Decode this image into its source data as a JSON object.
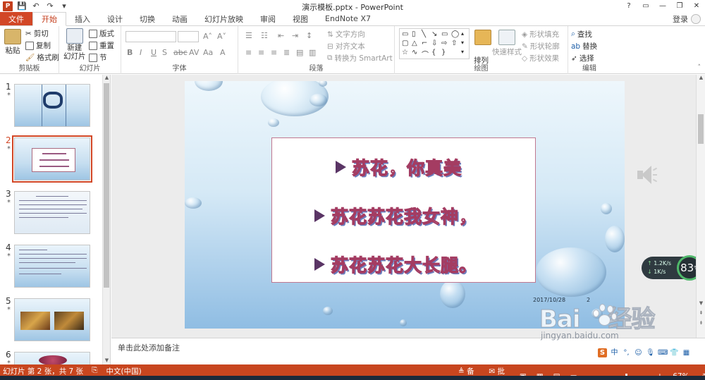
{
  "window": {
    "title": "演示模板.pptx - PowerPoint",
    "login": "登录",
    "help_glyph": "?",
    "minimize_glyph": "—",
    "restore_glyph": "❐",
    "close_glyph": "✕"
  },
  "quick_access": {
    "app_glyph": "P",
    "save_glyph": "💾",
    "undo_glyph": "↶",
    "redo_glyph": "↷",
    "customize_glyph": "▾"
  },
  "tabs": [
    {
      "label": "文件"
    },
    {
      "label": "开始"
    },
    {
      "label": "插入"
    },
    {
      "label": "设计"
    },
    {
      "label": "切换"
    },
    {
      "label": "动画"
    },
    {
      "label": "幻灯片放映"
    },
    {
      "label": "审阅"
    },
    {
      "label": "视图"
    },
    {
      "label": "EndNote X7"
    }
  ],
  "ribbon": {
    "clipboard": {
      "paste": "粘贴",
      "cut": "剪切",
      "copy": "复制",
      "format_painter": "格式刷",
      "group_label": "剪贴板"
    },
    "slides": {
      "new_slide": "新建",
      "new_slide_line2": "幻灯片",
      "layout": "版式",
      "reset": "重置",
      "section": "节",
      "group_label": "幻灯片"
    },
    "font": {
      "bold": "B",
      "italic": "I",
      "underline": "U",
      "strike": "S",
      "spacing": "abc",
      "shadow": "AV",
      "case": "Aa",
      "group_label": "字体"
    },
    "paragraph": {
      "text_direction": "文字方向",
      "align_text": "对齐文本",
      "smartart": "转换为 SmartArt",
      "group_label": "段落"
    },
    "drawing": {
      "arrange": "排列",
      "quick_styles": "快速样式",
      "shape_fill": "形状填充",
      "shape_outline": "形状轮廓",
      "shape_effects": "形状效果",
      "group_label": "绘图"
    },
    "editing": {
      "find": "查找",
      "replace": "替换",
      "select": "选择",
      "group_label": "编辑"
    }
  },
  "thumbnails": [
    {
      "number": "1",
      "star": "*"
    },
    {
      "number": "2",
      "star": "*"
    },
    {
      "number": "3",
      "star": "*"
    },
    {
      "number": "4",
      "star": "*"
    },
    {
      "number": "5",
      "star": "*"
    },
    {
      "number": "6",
      "star": "*"
    }
  ],
  "slide": {
    "bullets": [
      "苏花，你真美",
      "苏花苏花我女神，",
      "苏花苏花大长腿。"
    ],
    "date": "2017/10/28",
    "page_number": "2"
  },
  "notes": {
    "placeholder": "单击此处添加备注"
  },
  "net_widget": {
    "up_speed": "1.2K/s",
    "down_speed": "1K/s",
    "percent": "83",
    "percent_unit": "%"
  },
  "watermark": {
    "brand": "Bai",
    "brand_tail": "经验",
    "url": "jingyan.baidu.com"
  },
  "status_bar": {
    "slide_info": "幻灯片 第 2 张，共 7 张",
    "language": "中文(中国)",
    "notes": "备注",
    "comments": "批注",
    "zoom": "67%"
  },
  "colors": {
    "accent": "#d24726",
    "status_bar": "#c8461f",
    "bullet_text_outline": "#a43c62"
  }
}
